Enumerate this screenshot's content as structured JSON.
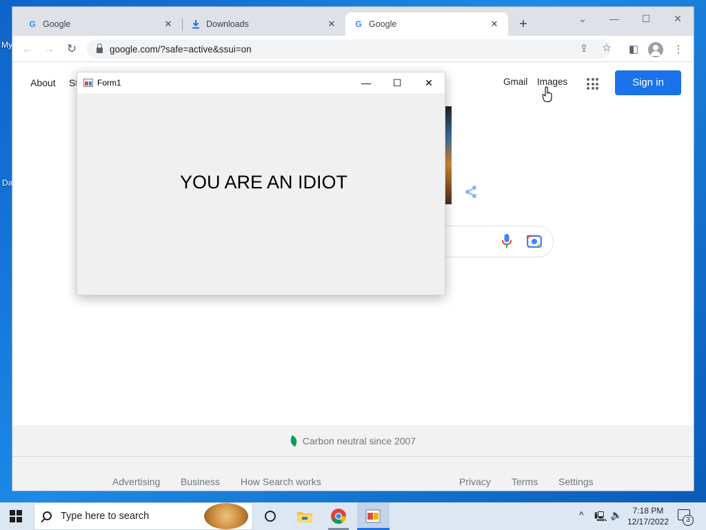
{
  "desktop": {
    "icon_labels": [
      "My",
      "Da"
    ]
  },
  "browser": {
    "tabs": [
      {
        "label": "Google",
        "icon": "google-g-icon",
        "active": false
      },
      {
        "label": "Downloads",
        "icon": "download-icon",
        "active": false
      },
      {
        "label": "Google",
        "icon": "google-g-icon",
        "active": true
      }
    ],
    "close_glyph": "✕",
    "new_tab_glyph": "+",
    "url": "google.com/?safe=active&ssui=on",
    "window_controls": {
      "tab_search": "⌄",
      "minimize": "—",
      "maximize": "☐",
      "close": "✕"
    }
  },
  "google": {
    "left_links": [
      "About",
      "St"
    ],
    "right_links": [
      "Gmail",
      "Images"
    ],
    "sign_in_label": "Sign in",
    "footer": {
      "carbon_text": "Carbon neutral since 2007",
      "left_links": [
        "Advertising",
        "Business",
        "How Search works"
      ],
      "right_links": [
        "Privacy",
        "Terms",
        "Settings"
      ]
    }
  },
  "form1": {
    "title": "Form1",
    "message": "YOU ARE AN IDIOT",
    "controls": {
      "minimize": "—",
      "maximize": "☐",
      "close": "✕"
    }
  },
  "taskbar": {
    "search_placeholder": "Type here to search",
    "time": "7:18 PM",
    "date": "12/17/2022",
    "notification_count": "3"
  },
  "colors": {
    "signin_blue": "#1a73e8",
    "desktop_blue": "#1d8ae6",
    "taskbar_bg": "#dde7f3"
  }
}
